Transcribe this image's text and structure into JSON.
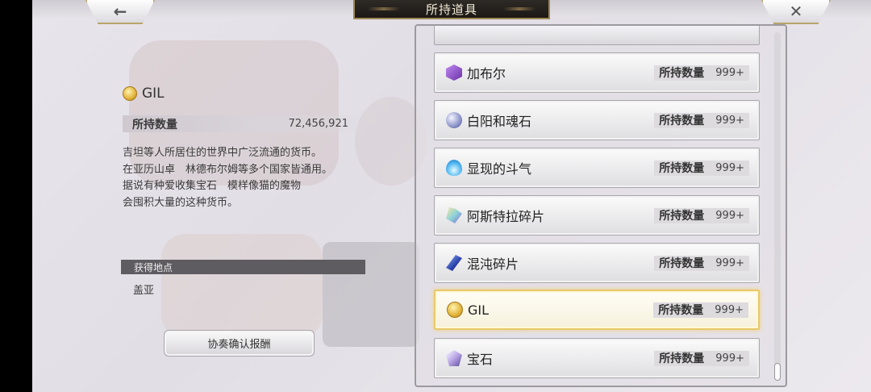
{
  "header": {
    "title": "所持道具",
    "back_icon": "←",
    "close_icon": "✕"
  },
  "detail": {
    "icon": "gil-coin-icon",
    "name": "GIL",
    "quantity_label": "所持数量",
    "quantity_value": "72,456,921",
    "description": [
      "吉坦等人所居住的世界中广泛流通的货币。",
      "在亚历山卓　林德布尔姆等多个国家皆通用。",
      "据说有种爱收集宝石　模样像猫的魔物",
      "会囤积大量的这种货币。"
    ],
    "source_label": "获得地点",
    "source_value": "盖亚",
    "reward_button": "协奏确认报酬"
  },
  "items": [
    {
      "name": "加布尔",
      "icon": "purple-cube-icon",
      "count_label": "所持数量",
      "count": "999+",
      "selected": false
    },
    {
      "name": "白阳和魂石",
      "icon": "soul-stone-icon",
      "count_label": "所持数量",
      "count": "999+",
      "selected": false
    },
    {
      "name": "显现的斗气",
      "icon": "blue-flame-icon",
      "count_label": "所持数量",
      "count": "999+",
      "selected": false
    },
    {
      "name": "阿斯特拉碎片",
      "icon": "astra-shard-icon",
      "count_label": "所持数量",
      "count": "999+",
      "selected": false
    },
    {
      "name": "混沌碎片",
      "icon": "chaos-shard-icon",
      "count_label": "所持数量",
      "count": "999+",
      "selected": false
    },
    {
      "name": "GIL",
      "icon": "gil-coin-icon",
      "count_label": "所持数量",
      "count": "999+",
      "selected": true
    },
    {
      "name": "宝石",
      "icon": "gem-icon",
      "count_label": "所持数量",
      "count": "999+",
      "selected": false
    }
  ],
  "colors": {
    "selected_border": "#e8c86a",
    "title_plate": "#1b1815"
  }
}
